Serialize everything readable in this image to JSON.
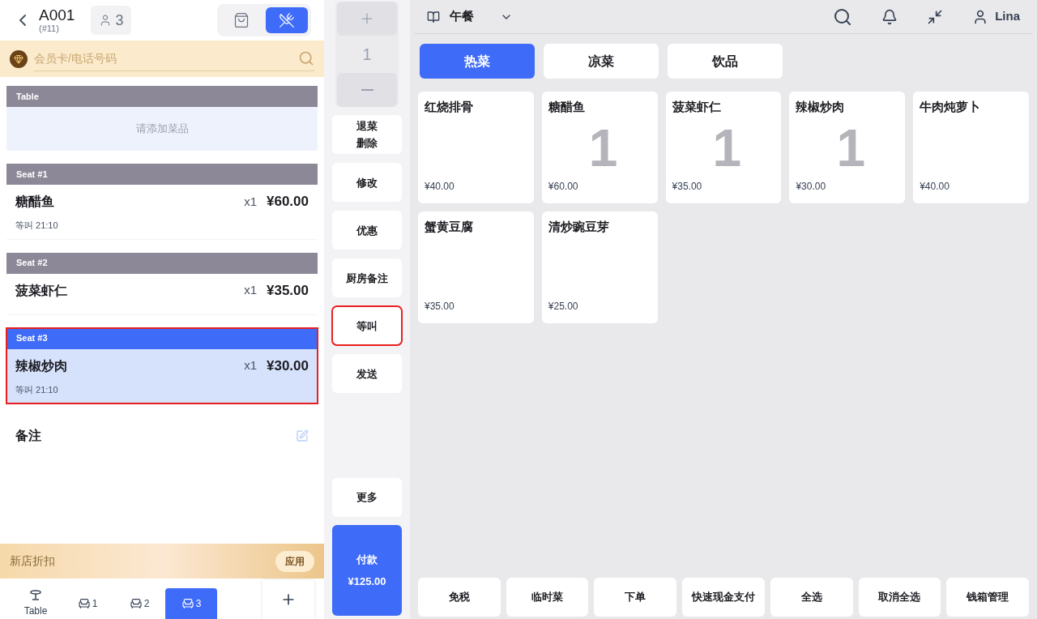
{
  "header": {
    "table": "A001",
    "order_no": "(#11)",
    "guests": "3",
    "modes": [
      {
        "kind": "takeaway",
        "selected": false
      },
      {
        "kind": "dine_in",
        "selected": true
      }
    ]
  },
  "member_search": {
    "placeholder": "会员卡/电话号码"
  },
  "order_groups": [
    {
      "label": "Table",
      "selected": false,
      "highlighted": false,
      "empty_text": "请添加菜品"
    },
    {
      "label": "Seat #1",
      "selected": false,
      "highlighted": false,
      "items": [
        {
          "name": "糖醋鱼",
          "qty": "x1",
          "price": "¥60.00",
          "note": "等叫 21:10"
        }
      ]
    },
    {
      "label": "Seat #2",
      "selected": false,
      "highlighted": false,
      "items": [
        {
          "name": "菠菜虾仁",
          "qty": "x1",
          "price": "¥35.00"
        }
      ]
    },
    {
      "label": "Seat #3",
      "selected": true,
      "highlighted": true,
      "items": [
        {
          "name": "辣椒炒肉",
          "qty": "x1",
          "price": "¥30.00",
          "note": "等叫 21:10"
        }
      ]
    }
  ],
  "remarks": {
    "label": "备注"
  },
  "discount": {
    "label": "新店折扣",
    "button": "应用"
  },
  "seat_tabs": [
    {
      "kind": "table",
      "label": "Table",
      "selected": false
    },
    {
      "kind": "seat",
      "label": "1",
      "selected": false
    },
    {
      "kind": "seat",
      "label": "2",
      "selected": false
    },
    {
      "kind": "seat",
      "label": "3",
      "selected": true
    }
  ],
  "stepper": {
    "value": "1"
  },
  "actions": [
    {
      "lines": [
        "退菜",
        "删除"
      ],
      "highlighted": false
    },
    {
      "lines": [
        "修改"
      ],
      "highlighted": false
    },
    {
      "lines": [
        "优惠"
      ],
      "highlighted": false
    },
    {
      "lines": [
        "厨房备注"
      ],
      "highlighted": false
    },
    {
      "lines": [
        "等叫"
      ],
      "highlighted": true
    },
    {
      "lines": [
        "发送"
      ],
      "highlighted": false
    }
  ],
  "more_button": "更多",
  "pay_button": {
    "label": "付款",
    "total": "¥125.00"
  },
  "menu": {
    "name": "午餐"
  },
  "user": {
    "name": "Lina"
  },
  "categories": [
    {
      "label": "热菜",
      "selected": true
    },
    {
      "label": "凉菜",
      "selected": false
    },
    {
      "label": "饮品",
      "selected": false
    }
  ],
  "dishes": [
    {
      "name": "红烧排骨",
      "price": "¥40.00"
    },
    {
      "name": "糖醋鱼",
      "price": "¥60.00",
      "count": "1"
    },
    {
      "name": "菠菜虾仁",
      "price": "¥35.00",
      "count": "1"
    },
    {
      "name": "辣椒炒肉",
      "price": "¥30.00",
      "count": "1"
    },
    {
      "name": "牛肉炖萝卜",
      "price": "¥40.00"
    },
    {
      "name": "蟹黄豆腐",
      "price": "¥35.00"
    },
    {
      "name": "清炒豌豆芽",
      "price": "¥25.00"
    }
  ],
  "bottom_actions": [
    "免税",
    "临时菜",
    "下单",
    "快速现金支付",
    "全选",
    "取消全选",
    "钱箱管理"
  ]
}
